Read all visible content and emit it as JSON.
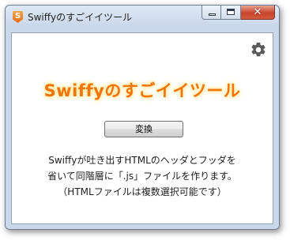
{
  "window": {
    "title": "Swiffyのすごイイツール",
    "app_icon_glyph": "S",
    "minimize_icon": "minimize-icon",
    "maximize_icon": "maximize-icon",
    "close_icon": "close-icon",
    "close_glyph": "✕"
  },
  "main": {
    "settings_icon": "gear-icon",
    "banner_title": "Swiffyのすごイイツール",
    "convert_button_label": "変換",
    "description_lines": [
      "Swiffyが吐き出すHTMLのヘッダとフッダを",
      "省いて同階層に「.js」ファイルを作ります。",
      "（HTMLファイルは複数選択可能です）"
    ]
  },
  "colors": {
    "banner_text": "#f1740c",
    "banner_glow": "#ffe38a",
    "title_bar": "#c9d8ea",
    "close_button": "#c9442c"
  }
}
